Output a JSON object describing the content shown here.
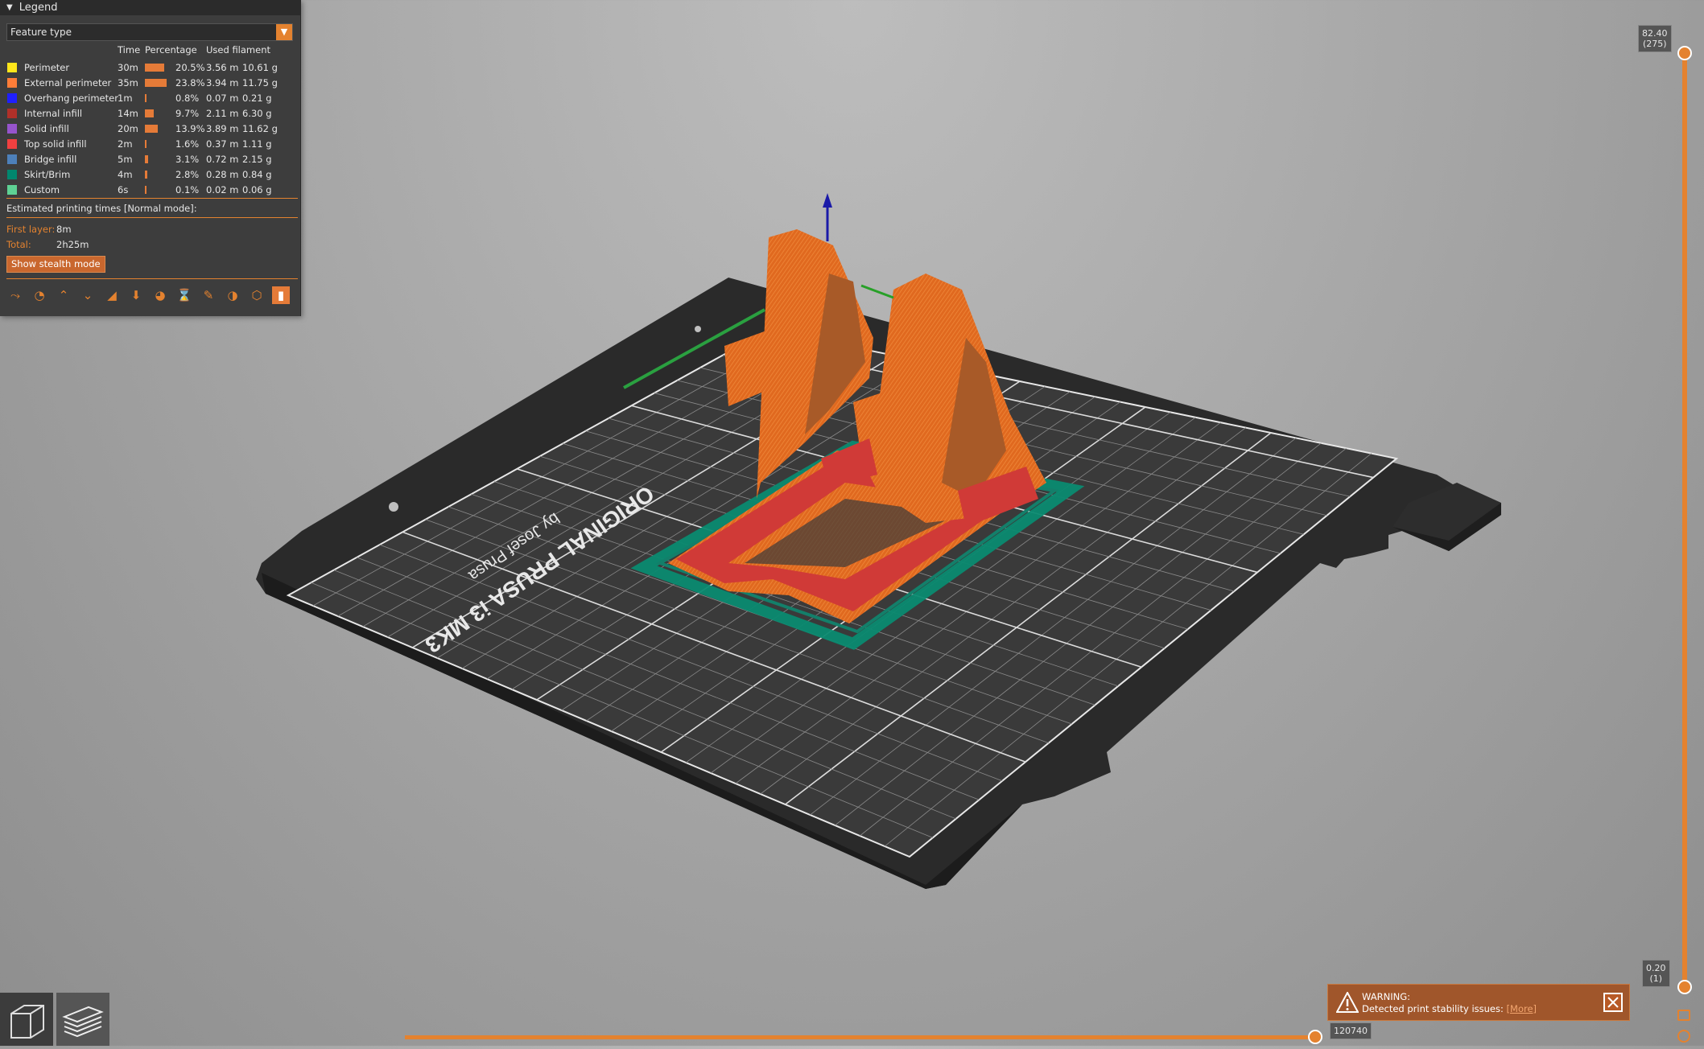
{
  "legend": {
    "title": "Legend",
    "view_type": "Feature type",
    "columns": {
      "time": "Time",
      "percentage": "Percentage",
      "used_filament": "Used filament"
    },
    "rows": [
      {
        "name": "Perimeter",
        "color": "#ffe61a",
        "time": "30m",
        "pct": "20.5%",
        "pct_value": 20.5,
        "length": "3.56 m",
        "weight": "10.61 g"
      },
      {
        "name": "External perimeter",
        "color": "#ff7d38",
        "time": "35m",
        "pct": "23.8%",
        "pct_value": 23.8,
        "length": "3.94 m",
        "weight": "11.75 g"
      },
      {
        "name": "Overhang perimeter",
        "color": "#1f1fff",
        "time": "1m",
        "pct": "0.8%",
        "pct_value": 0.8,
        "length": "0.07 m",
        "weight": "0.21 g"
      },
      {
        "name": "Internal infill",
        "color": "#b03029",
        "time": "14m",
        "pct": "9.7%",
        "pct_value": 9.7,
        "length": "2.11 m",
        "weight": "6.30 g"
      },
      {
        "name": "Solid infill",
        "color": "#9654cc",
        "time": "20m",
        "pct": "13.9%",
        "pct_value": 13.9,
        "length": "3.89 m",
        "weight": "11.62 g"
      },
      {
        "name": "Top solid infill",
        "color": "#f04040",
        "time": "2m",
        "pct": "1.6%",
        "pct_value": 1.6,
        "length": "0.37 m",
        "weight": "1.11 g"
      },
      {
        "name": "Bridge infill",
        "color": "#4d80ba",
        "time": "5m",
        "pct": "3.1%",
        "pct_value": 3.1,
        "length": "0.72 m",
        "weight": "2.15 g"
      },
      {
        "name": "Skirt/Brim",
        "color": "#00876e",
        "time": "4m",
        "pct": "2.8%",
        "pct_value": 2.8,
        "length": "0.28 m",
        "weight": "0.84 g"
      },
      {
        "name": "Custom",
        "color": "#5ed194",
        "time": "6s",
        "pct": "0.1%",
        "pct_value": 0.1,
        "length": "0.02 m",
        "weight": "0.06 g"
      }
    ],
    "estimated_title": "Estimated printing times [Normal mode]:",
    "first_layer_label": "First layer:",
    "first_layer_value": "8m",
    "total_label": "Total:",
    "total_value": "2h25m",
    "stealth_button": "Show stealth mode",
    "option_icons": [
      "travel-icon",
      "wipe-icon",
      "retractions-icon",
      "deretractions-icon",
      "seams-icon",
      "tool-changes-icon",
      "color-changes-icon",
      "pause-icon",
      "custom-gcode-icon",
      "cog-icon",
      "shells-icon",
      "tool-marker-icon"
    ],
    "selected_option": 11
  },
  "bed": {
    "brand_line1": "ORIGINAL PRUSA i3 MK3",
    "brand_line2": "by Josef Prusa"
  },
  "vertical_slider": {
    "top_value": "82.40",
    "top_layer": "(275)",
    "bottom_value": "0.20",
    "bottom_layer": "(1)"
  },
  "horizontal_slider": {
    "value": "120740"
  },
  "warning": {
    "title": "WARNING:",
    "message": "Detected print stability issues:",
    "link": "[More]"
  },
  "colors": {
    "accent": "#e4822f",
    "panel": "#3d3d3d",
    "bed": "#333333",
    "part": "#e36d26"
  }
}
